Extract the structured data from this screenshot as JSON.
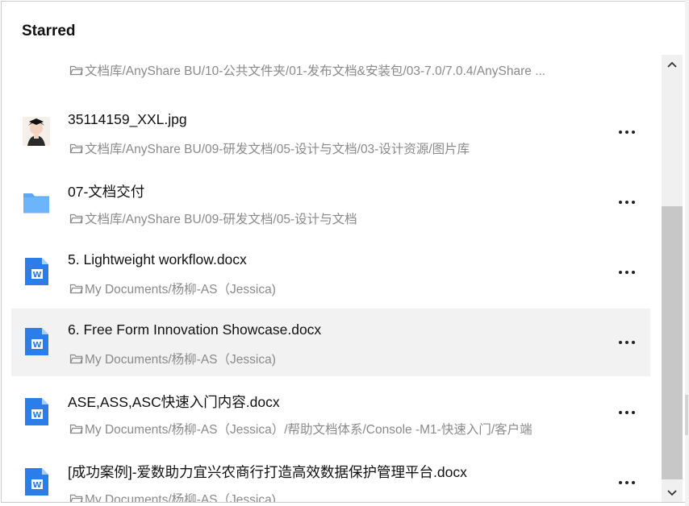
{
  "panel": {
    "title": "Starred"
  },
  "colors": {
    "accent_teal": "#13c2a3",
    "folder_blue": "#5aa9f5",
    "word_blue": "#2b7de9",
    "selected_bg": "#f2f2f2"
  },
  "items": [
    {
      "name": "",
      "path": "文档库/AnyShare BU/10-公共文件夹/01-发布文档&安装包/03-7.0/7.0.4/AnyShare ...",
      "icon": "teal-file-icon"
    },
    {
      "name": "35114159_XXL.jpg",
      "path": "文档库/AnyShare BU/09-研发文档/05-设计与文档/03-设计资源/图片库",
      "icon": "image-thumbnail"
    },
    {
      "name": "07-文档交付",
      "path": "文档库/AnyShare BU/09-研发文档/05-设计与文档",
      "icon": "folder-icon"
    },
    {
      "name": "5. Lightweight workflow.docx",
      "path": "My Documents/杨柳-AS（Jessica)",
      "icon": "word-doc-icon"
    },
    {
      "name": "6. Free Form Innovation Showcase.docx",
      "path": "My Documents/杨柳-AS（Jessica)",
      "icon": "word-doc-icon"
    },
    {
      "name": "ASE,ASS,ASC快速入门内容.docx",
      "path": "My Documents/杨柳-AS（Jessica）/帮助文档体系/Console -M1-快速入门/客户端",
      "icon": "word-doc-icon"
    },
    {
      "name": "[成功案例]-爱数助力宜兴农商行打造高效数据保护管理平台.docx",
      "path": "My Documents/杨柳-AS（Jessica)",
      "icon": "word-doc-icon"
    }
  ]
}
